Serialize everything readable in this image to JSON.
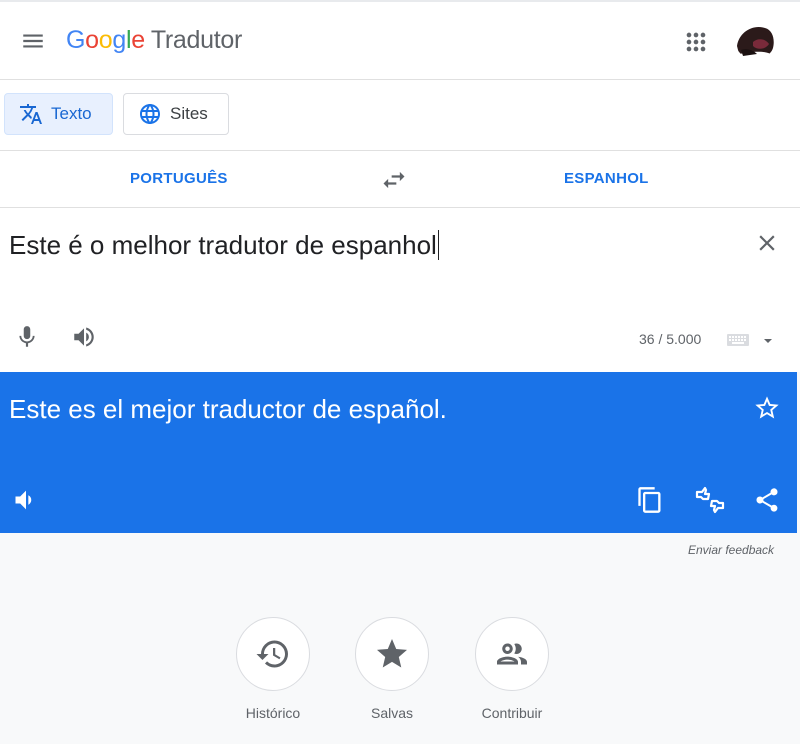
{
  "app": {
    "logo_letters": [
      "G",
      "o",
      "o",
      "g",
      "l",
      "e"
    ],
    "product_name": "Tradutor"
  },
  "icons": {
    "menu": "menu-icon",
    "apps": "apps-grid-icon",
    "avatar": "avatar",
    "translate": "translate-icon",
    "globe": "globe-icon",
    "swap": "swap-arrows-icon",
    "clear": "close-icon",
    "mic": "mic-icon",
    "volume": "volume-icon",
    "keyboard": "keyboard-icon",
    "dropdown": "caret-down-icon",
    "star": "star-outline-icon",
    "copy": "copy-icon",
    "feedback": "thumbs-feedback-icon",
    "share": "share-icon",
    "history": "history-icon",
    "saved": "star-filled-icon",
    "community": "people-icon"
  },
  "modes": {
    "text_label": "Texto",
    "sites_label": "Sites"
  },
  "languages": {
    "source": "PORTUGUÊS",
    "target": "ESPANHOL"
  },
  "source": {
    "text": "Este é o melhor tradutor de espanhol",
    "char_count": "36 / 5.000"
  },
  "result": {
    "text": "Este es el mejor traductor de español."
  },
  "feedback_link": "Enviar feedback",
  "bottom_buttons": {
    "history": "Histórico",
    "saved": "Salvas",
    "contribute": "Contribuir"
  },
  "colors": {
    "accent": "#1a73e8",
    "active_mode_bg": "#e8f0fe",
    "page_bg": "#f8f9fa"
  }
}
